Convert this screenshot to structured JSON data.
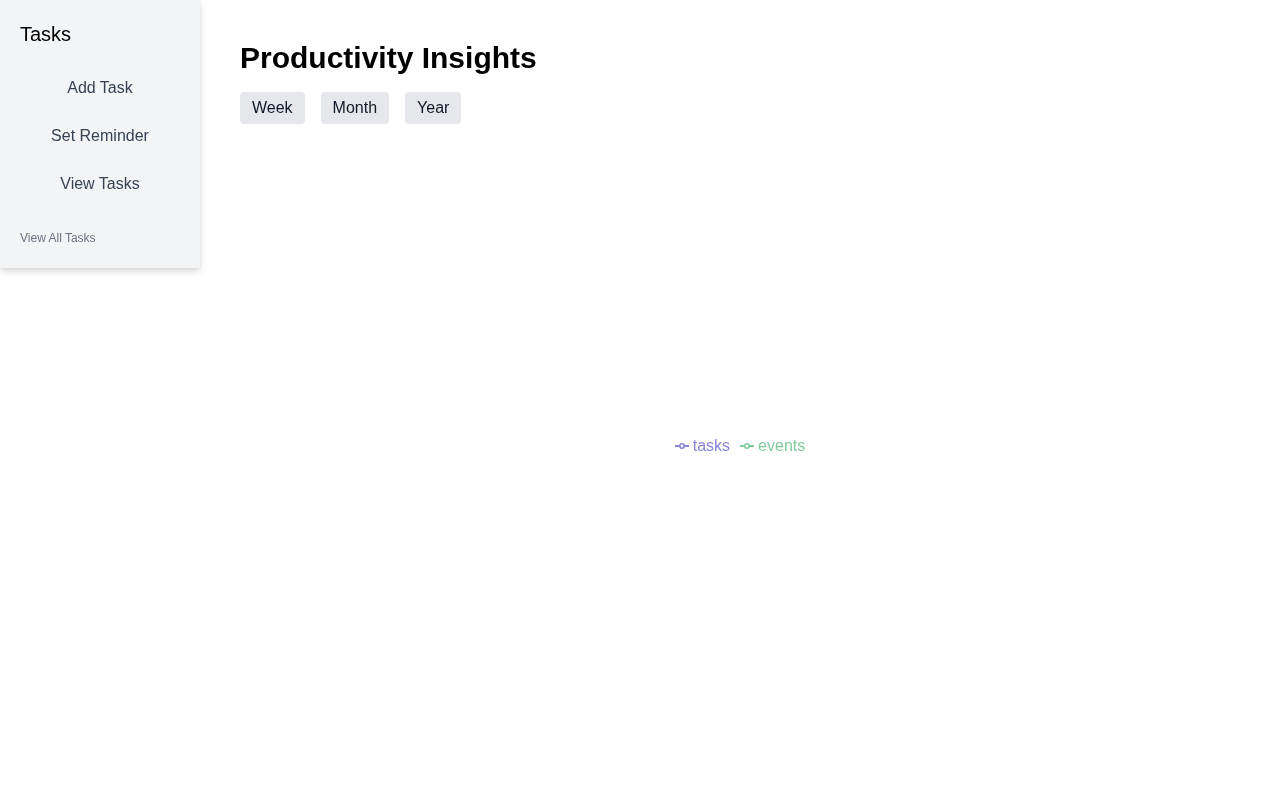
{
  "sidebar": {
    "title": "Tasks",
    "items": [
      "Add Task",
      "Set Reminder",
      "View Tasks"
    ],
    "footer_link": "View All Tasks"
  },
  "main": {
    "title": "Productivity Insights",
    "ranges": [
      {
        "label": "Week",
        "selected": false
      },
      {
        "label": "Month",
        "selected": false
      },
      {
        "label": "Year",
        "selected": false
      }
    ],
    "chart": {
      "legend": [
        {
          "label": "tasks",
          "color": "#8884d8"
        },
        {
          "label": "events",
          "color": "#82ca9d"
        }
      ]
    }
  }
}
